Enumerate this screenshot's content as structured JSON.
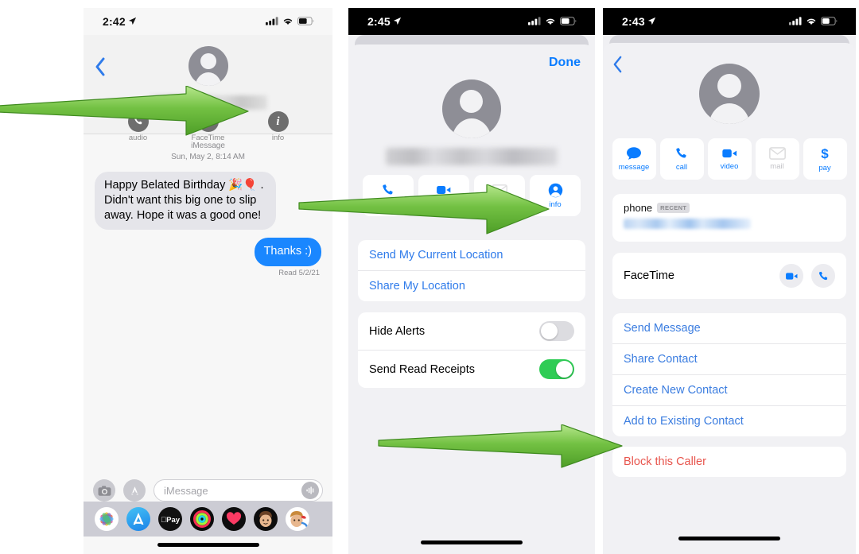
{
  "phone1": {
    "name": "messages-conversation",
    "status": {
      "time": "2:42",
      "location_icon": "location-arrow-icon",
      "cellular": "cellular-icon",
      "wifi": "wifi-icon",
      "battery": "battery-icon"
    },
    "back_label": "back-chevron",
    "header_actions": [
      {
        "id": "audio",
        "label": "audio",
        "glyph": "phone-icon"
      },
      {
        "id": "facetime",
        "label": "FaceTime",
        "glyph": "video-icon"
      },
      {
        "id": "info",
        "label": "info",
        "glyph": "info-icon"
      }
    ],
    "conversation": {
      "service": "iMessage",
      "datestamp": "Sun, May 2, 8:14 AM",
      "messages": [
        {
          "side": "incoming",
          "text": "Happy Belated Birthday 🎉🎈 . Didn't want this big one to slip away. Hope it was a good one!"
        },
        {
          "side": "outgoing",
          "text": "Thanks :)"
        }
      ],
      "read_receipt": "Read 5/2/21"
    },
    "composer": {
      "camera_icon": "camera-icon",
      "apps_icon": "app-store-icon",
      "placeholder": "iMessage",
      "mic_icon": "audio-waveform-icon"
    },
    "app_drawer": [
      {
        "id": "photos",
        "label": "photos-app-icon"
      },
      {
        "id": "appstore",
        "label": "app-store-app-icon"
      },
      {
        "id": "applepay",
        "label": "apple-pay-app-icon"
      },
      {
        "id": "fitness",
        "label": "fitness-rings-app-icon"
      },
      {
        "id": "health",
        "label": "health-app-icon"
      },
      {
        "id": "memoji1",
        "label": "memoji-app-icon"
      },
      {
        "id": "memoji2",
        "label": "memoji-stickers-app-icon"
      }
    ]
  },
  "phone2": {
    "name": "message-details-sheet",
    "status": {
      "time": "2:45"
    },
    "done_label": "Done",
    "action_buttons": [
      {
        "id": "call",
        "label": "call",
        "glyph": "phone-icon",
        "muted": false
      },
      {
        "id": "video",
        "label": "video",
        "glyph": "video-icon",
        "muted": false
      },
      {
        "id": "mail",
        "label": "mail",
        "glyph": "mail-icon",
        "muted": true
      },
      {
        "id": "info",
        "label": "info",
        "glyph": "person-circle-icon",
        "muted": false
      }
    ],
    "location_rows": [
      {
        "label": "Send My Current Location"
      },
      {
        "label": "Share My Location"
      }
    ],
    "toggle_rows": [
      {
        "label": "Hide Alerts",
        "state": "off"
      },
      {
        "label": "Send Read Receipts",
        "state": "on"
      }
    ]
  },
  "phone3": {
    "name": "contact-info-card",
    "status": {
      "time": "2:43"
    },
    "back_label": "back-chevron",
    "action_buttons": [
      {
        "id": "message",
        "label": "message",
        "glyph": "message-bubble-icon",
        "muted": false
      },
      {
        "id": "call",
        "label": "call",
        "glyph": "phone-icon",
        "muted": false
      },
      {
        "id": "video",
        "label": "video",
        "glyph": "video-icon",
        "muted": false
      },
      {
        "id": "mail",
        "label": "mail",
        "glyph": "mail-icon",
        "muted": true
      },
      {
        "id": "pay",
        "label": "pay",
        "glyph": "dollar-sign-icon",
        "muted": false
      }
    ],
    "phone_field": {
      "label": "phone",
      "badge": "RECENT",
      "value_redacted": true
    },
    "facetime_row": {
      "label": "FaceTime",
      "video_icon": "video-icon",
      "audio_icon": "phone-icon"
    },
    "menu_rows": [
      {
        "label": "Send Message",
        "style": "link"
      },
      {
        "label": "Share Contact",
        "style": "link"
      },
      {
        "label": "Create New Contact",
        "style": "link"
      },
      {
        "label": "Add to Existing Contact",
        "style": "link"
      }
    ],
    "block_row": {
      "label": "Block this Caller",
      "style": "danger"
    }
  },
  "annotations": {
    "arrows": [
      {
        "id": "arrow-to-info-phone1",
        "target": "info-button"
      },
      {
        "id": "arrow-to-info-phone2",
        "target": "info-button"
      },
      {
        "id": "arrow-to-block-caller",
        "target": "block-this-caller-row"
      }
    ],
    "arrow_color": "#65bb3c",
    "arrow_color_light": "#a8e07a"
  },
  "colors": {
    "ios_blue": "#0a7cff",
    "link_blue": "#3b7de0",
    "danger_red": "#e8554d",
    "toggle_green": "#2fcc55",
    "bubble_blue": "#1a87ff",
    "bubble_grey": "#e5e5ea"
  }
}
